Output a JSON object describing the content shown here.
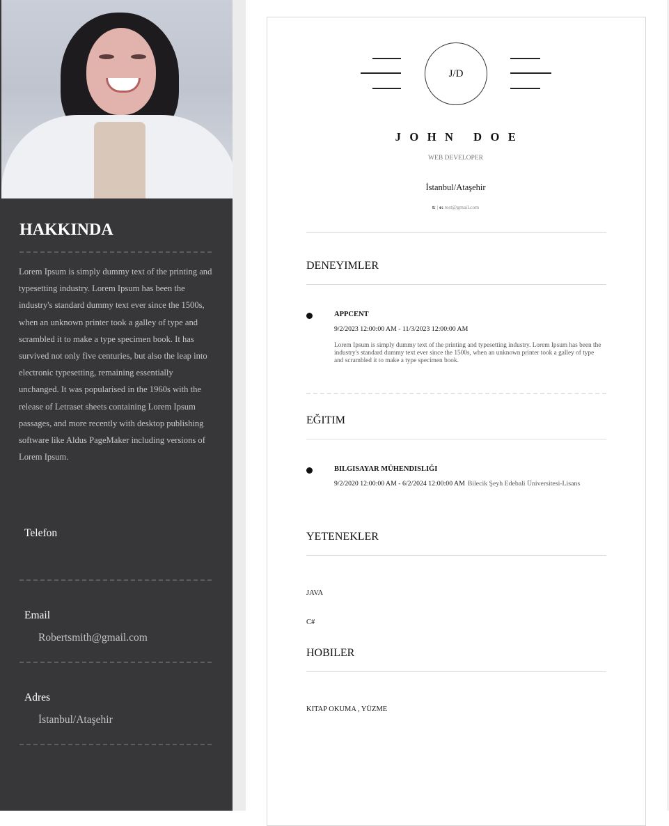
{
  "sidebar": {
    "about_title": "HAKKINDA",
    "about_text": "Lorem Ipsum is simply dummy text of the printing and typesetting industry. Lorem Ipsum has been the industry's standard dummy text ever since the 1500s, when an unknown printer took a galley of type and scrambled it to make a type specimen book. It has survived not only five centuries, but also the leap into electronic typesetting, remaining essentially unchanged. It was popularised in the 1960s with the release of Letraset sheets containing Lorem Ipsum passages, and more recently with desktop publishing software like Aldus PageMaker including versions of Lorem Ipsum.",
    "phone_label": "Telefon",
    "phone_value": "",
    "email_label": "Email",
    "email_value": "Robertsmith@gmail.com",
    "address_label": "Adres",
    "address_value": "İstanbul/Ataşehir"
  },
  "header": {
    "monogram": "J/D",
    "name": "JOHN DOE",
    "role": "WEB DEVELOPER",
    "location": "İstanbul/Ataşehir",
    "contact_t_label": "t:",
    "contact_sep": "|",
    "contact_e_label": "e:",
    "contact_email": "test@gmail.com"
  },
  "experience": {
    "title": "DENEYIMLER",
    "items": [
      {
        "company": "APPCENT",
        "dates": "9/2/2023 12:00:00 AM - 11/3/2023 12:00:00 AM",
        "description": "Lorem Ipsum is simply dummy text of the printing and typesetting industry. Lorem Ipsum has been the industry's standard dummy text ever since the 1500s, when an unknown printer took a galley of type and scrambled it to make a type specimen book."
      }
    ]
  },
  "education": {
    "title": "EĞITIM",
    "items": [
      {
        "degree": "BILGISAYAR MÜHENDISLIĞI",
        "dates": "9/2/2020 12:00:00 AM - 6/2/2024 12:00:00 AM",
        "school": "Bilecik Şeyh Edebali Üniversitesi-Lisans"
      }
    ]
  },
  "skills": {
    "title": "YETENEKLER",
    "items": [
      "JAVA",
      "C#"
    ]
  },
  "hobbies": {
    "title": "HOBILER",
    "text": "KITAP OKUMA , YÜZME"
  },
  "colors": {
    "sidebar_bg": "#373739",
    "sidebar_text": "#c7c7c9",
    "accent_text": "#111111"
  }
}
